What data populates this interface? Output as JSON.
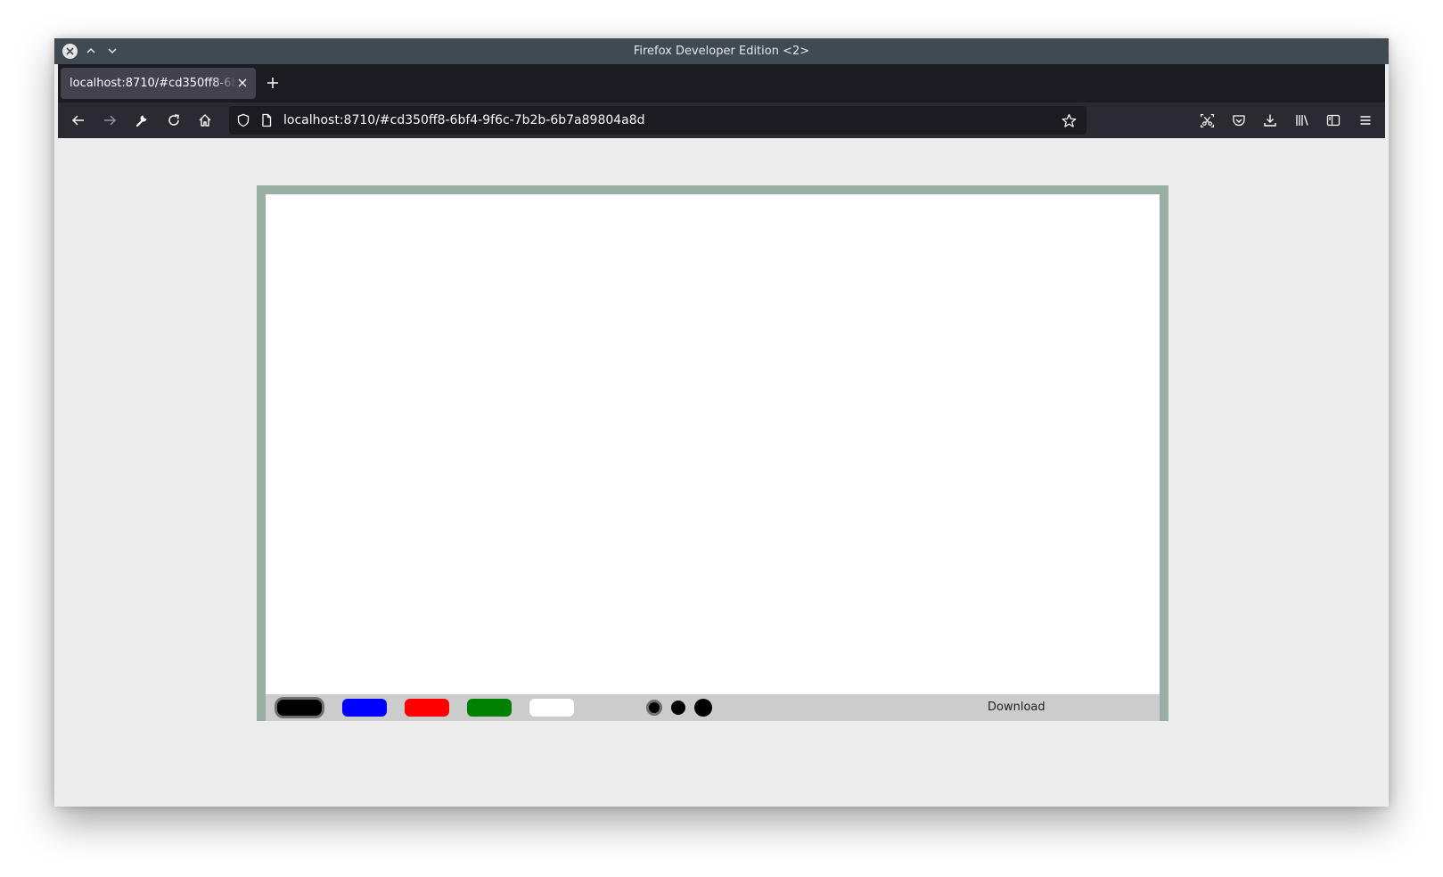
{
  "window": {
    "title": "Firefox Developer Edition <2>"
  },
  "tabs": [
    {
      "label": "localhost:8710/#cd350ff8-6bf4-9f6c-7b2b-6b7a89804a8d"
    }
  ],
  "urlbar": {
    "url": "localhost:8710/#cd350ff8-6bf4-9f6c-7b2b-6b7a89804a8d"
  },
  "toolbar": {
    "colors": [
      {
        "name": "black",
        "hex": "#000000",
        "selected": true
      },
      {
        "name": "blue",
        "hex": "#0000ff",
        "selected": false
      },
      {
        "name": "red",
        "hex": "#ff0000",
        "selected": false
      },
      {
        "name": "green",
        "hex": "#008000",
        "selected": false
      },
      {
        "name": "white",
        "hex": "#ffffff",
        "selected": false
      }
    ],
    "brush_sizes": [
      "small",
      "medium",
      "large"
    ],
    "selected_brush": "small",
    "download_label": "Download"
  },
  "theme": {
    "board_border": "#9aafa3",
    "toolbar_bg": "#cccccc",
    "page_bg": "#ededed"
  }
}
